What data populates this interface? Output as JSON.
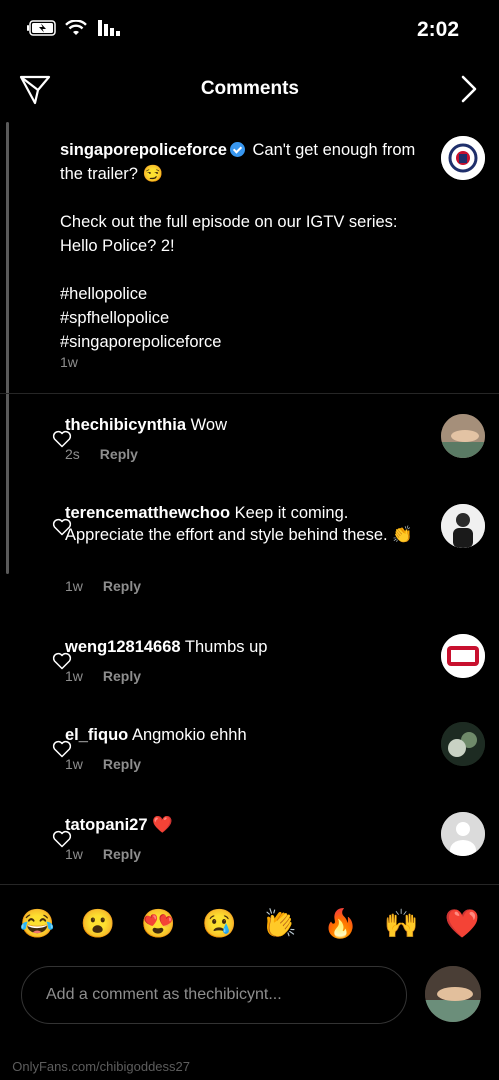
{
  "status_bar": {
    "time": "2:02"
  },
  "header": {
    "title": "Comments"
  },
  "caption": {
    "username": "singaporepoliceforce",
    "line1": "Can't get enough from the trailer? 😏",
    "line2": "Check out the full episode on our IGTV series: Hello Police? 2!",
    "hashtags": [
      "#hellopolice",
      "#spfhellopolice",
      "#singaporepoliceforce"
    ],
    "time": "1w"
  },
  "comments": [
    {
      "username": "thechibicynthia",
      "text": "Wow",
      "time": "2s",
      "reply": "Reply"
    },
    {
      "username": "terencematthewchoo",
      "text": "Keep it coming. Appreciate the effort and style behind these. 👏",
      "time": "1w",
      "reply": "Reply"
    },
    {
      "username": "weng12814668",
      "text": "Thumbs up",
      "time": "1w",
      "reply": "Reply"
    },
    {
      "username": "el_fiquo",
      "text": "Angmokio ehhh",
      "time": "1w",
      "reply": "Reply"
    },
    {
      "username": "tatopani27",
      "text": "❤️",
      "time": "1w",
      "reply": "Reply"
    }
  ],
  "emoji_bar": [
    "❤️",
    "🙌",
    "🔥",
    "👏",
    "😢",
    "😍",
    "😮",
    "😂"
  ],
  "composer": {
    "placeholder": "Add a comment as thechibicynt..."
  },
  "watermark": "OnlyFans.com/chibigoddess27",
  "colors": {
    "background": "#000000",
    "muted": "#8e8e8e",
    "verified": "#3897f0",
    "divider": "#262626"
  }
}
